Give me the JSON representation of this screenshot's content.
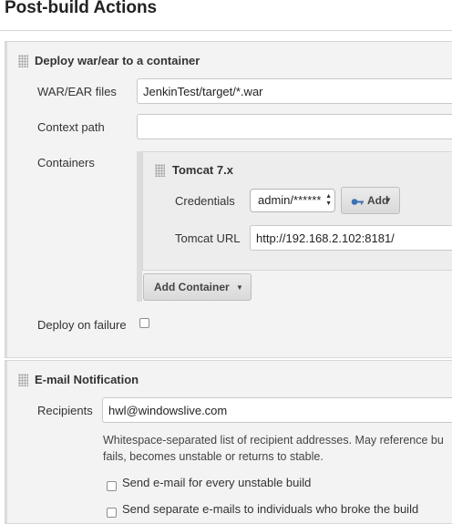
{
  "section": {
    "title": "Post-build Actions"
  },
  "deploy": {
    "heading": "Deploy war/ear to a container",
    "war_label": "WAR/EAR files",
    "war_value": "JenkinTest/target/*.war",
    "context_label": "Context path",
    "context_value": "",
    "containers_label": "Containers",
    "tomcat": {
      "heading": "Tomcat 7.x",
      "credentials_label": "Credentials",
      "credentials_value": "admin/******",
      "add_label": "Add",
      "url_label": "Tomcat URL",
      "url_value": "http://192.168.2.102:8181/"
    },
    "add_container_label": "Add Container",
    "failure_label": "Deploy on failure",
    "failure_checked": false
  },
  "email": {
    "heading": "E-mail Notification",
    "recipients_label": "Recipients",
    "recipients_value": "hwl@windowslive.com",
    "help_line1": "Whitespace-separated list of recipient addresses. May reference bu",
    "help_line2": "fails, becomes unstable or returns to stable.",
    "option1_label": "Send e-mail for every unstable build",
    "option1_checked": false,
    "option2_label": "Send separate e-mails to individuals who broke the build",
    "option2_checked": false
  }
}
